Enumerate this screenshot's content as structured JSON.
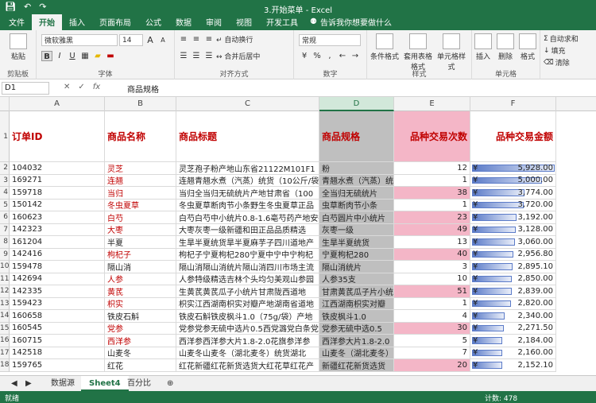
{
  "window": {
    "title": "3.开始菜单 - Excel"
  },
  "tabs": [
    "文件",
    "开始",
    "插入",
    "页面布局",
    "公式",
    "数据",
    "审阅",
    "视图",
    "开发工具"
  ],
  "active_tab": "开始",
  "tell_me": "告诉我你想要做什么",
  "ribbon": {
    "font_name": "微软雅黑",
    "font_size": "14",
    "wrap_text": "自动换行",
    "merge_center": "合并后居中",
    "number_format": "常规",
    "bold": "B",
    "italic": "I",
    "underline": "U",
    "font_grow": "A",
    "font_shrink": "A",
    "percent": "%",
    "comma": ",",
    "cond_format": "条件格式",
    "table_format": "套用表格格式",
    "cell_style": "单元格样式",
    "insert": "插入",
    "delete": "删除",
    "format": "格式",
    "autosum": "自动求和",
    "fill": "填充",
    "clear": "清除",
    "paste": "粘贴",
    "group_clipboard": "剪贴板",
    "group_font": "字体",
    "group_align": "对齐方式",
    "group_number": "数字",
    "group_styles": "样式",
    "group_cells": "单元格"
  },
  "formula_bar": {
    "name_box": "D1",
    "formula": "商品规格"
  },
  "columns": [
    "A",
    "B",
    "C",
    "D",
    "E",
    "F"
  ],
  "headers": [
    "订单ID",
    "商品名称",
    "商品标题",
    "商品规格",
    "品种交易次数",
    "品种交易金额"
  ],
  "rows": [
    {
      "n": "2",
      "id": "104032",
      "name": "灵芝",
      "title": "灵芝孢子粉产地山东省21122M101F1",
      "spec": "粉",
      "count": "12",
      "amount": "5,928.00",
      "red": true
    },
    {
      "n": "3",
      "id": "169271",
      "name": "连翘",
      "title": "连翘青翘水煮（汽蒸）统货（10公斤/袋）",
      "spec": "青翘水煮（汽蒸）统",
      "count": "1",
      "amount": "5,000.00",
      "red": true
    },
    {
      "n": "4",
      "id": "159718",
      "name": "当归",
      "title": "当归全当归无硫统片产地甘肃省（100",
      "spec": "全当归无硫统片",
      "count": "38",
      "amount": "3,774.00",
      "red": true
    },
    {
      "n": "5",
      "id": "150142",
      "name": "冬虫夏草",
      "title": "冬虫夏草断肉节小条野生冬虫夏草正品",
      "spec": "虫草断肉节小条",
      "count": "1",
      "amount": "3,720.00",
      "red": true
    },
    {
      "n": "6",
      "id": "160623",
      "name": "白芍",
      "title": "白芍白芍中小统片0.8-1.6亳芍药产地安徽",
      "spec": "白芍圆片中小统片",
      "count": "23",
      "amount": "3,192.00",
      "red": true
    },
    {
      "n": "7",
      "id": "142323",
      "name": "大枣",
      "title": "大枣灰枣一级新疆和田正品品质精选",
      "spec": "灰枣一级",
      "count": "49",
      "amount": "3,128.00",
      "red": true
    },
    {
      "n": "8",
      "id": "161204",
      "name": "半夏",
      "title": "生旱半夏统货旱半夏麻芋子四川道地产",
      "spec": "生旱半夏统货",
      "count": "13",
      "amount": "3,060.00",
      "red": false
    },
    {
      "n": "9",
      "id": "142416",
      "name": "枸杞子",
      "title": "枸杞子宁夏枸杞280宁夏中宁中宁枸杞",
      "spec": "宁夏枸杞280",
      "count": "40",
      "amount": "2,956.80",
      "red": true
    },
    {
      "n": "10",
      "id": "159478",
      "name": "隔山消",
      "title": "隔山消隔山消统片隔山消四川市场主流",
      "spec": "隔山消统片",
      "count": "3",
      "amount": "2,895.10",
      "red": false
    },
    {
      "n": "11",
      "id": "142694",
      "name": "人参",
      "title": "人参特级精选吉林个头均匀美观山参园",
      "spec": "人参35支",
      "count": "10",
      "amount": "2,850.00",
      "red": true
    },
    {
      "n": "12",
      "id": "142335",
      "name": "黄芪",
      "title": "生黄芪黄芪瓜子小统片甘肃陇西道地",
      "spec": "甘肃黄芪瓜子片小统",
      "count": "51",
      "amount": "2,839.00",
      "red": true
    },
    {
      "n": "13",
      "id": "159423",
      "name": "枳实",
      "title": "枳实江西湖南枳实对瓣产地湖南省道地",
      "spec": "江西湖南枳实对瓣",
      "count": "1",
      "amount": "2,820.00",
      "red": true
    },
    {
      "n": "14",
      "id": "160658",
      "name": "铁皮石斛",
      "title": "铁皮石斛铁皮枫斗1.0（75g/袋）产地",
      "spec": "铁皮枫斗1.0",
      "count": "4",
      "amount": "2,340.00",
      "red": false
    },
    {
      "n": "15",
      "id": "160545",
      "name": "党参",
      "title": "党参党参无硫中选片0.5西党潞党白条党",
      "spec": "党参无硫中选0.5",
      "count": "30",
      "amount": "2,271.50",
      "red": true
    },
    {
      "n": "16",
      "id": "160715",
      "name": "西洋参",
      "title": "西洋参西洋参大片1.8-2.0花旗参洋参",
      "spec": "西洋参大片1.8-2.0",
      "count": "5",
      "amount": "2,184.00",
      "red": true
    },
    {
      "n": "17",
      "id": "142518",
      "name": "山麦冬",
      "title": "山麦冬山麦冬（湖北麦冬）统货湖北",
      "spec": "山麦冬（湖北麦冬）",
      "count": "7",
      "amount": "2,160.00",
      "red": false
    },
    {
      "n": "18",
      "id": "159765",
      "name": "红花",
      "title": "红花新疆红花新货选货大红花草红花产",
      "spec": "新疆红花新货选货",
      "count": "20",
      "amount": "2,152.10",
      "red": false
    }
  ],
  "sheets": [
    "数据源",
    "Sheet4",
    "百分比"
  ],
  "active_sheet": "Sheet4",
  "status": {
    "left": "就绪",
    "right": "计数: 478"
  },
  "colors": {
    "accent": "#217346",
    "pink": "#f4b6c7",
    "bar": "#5b7bc8",
    "header_red": "#c00000"
  }
}
